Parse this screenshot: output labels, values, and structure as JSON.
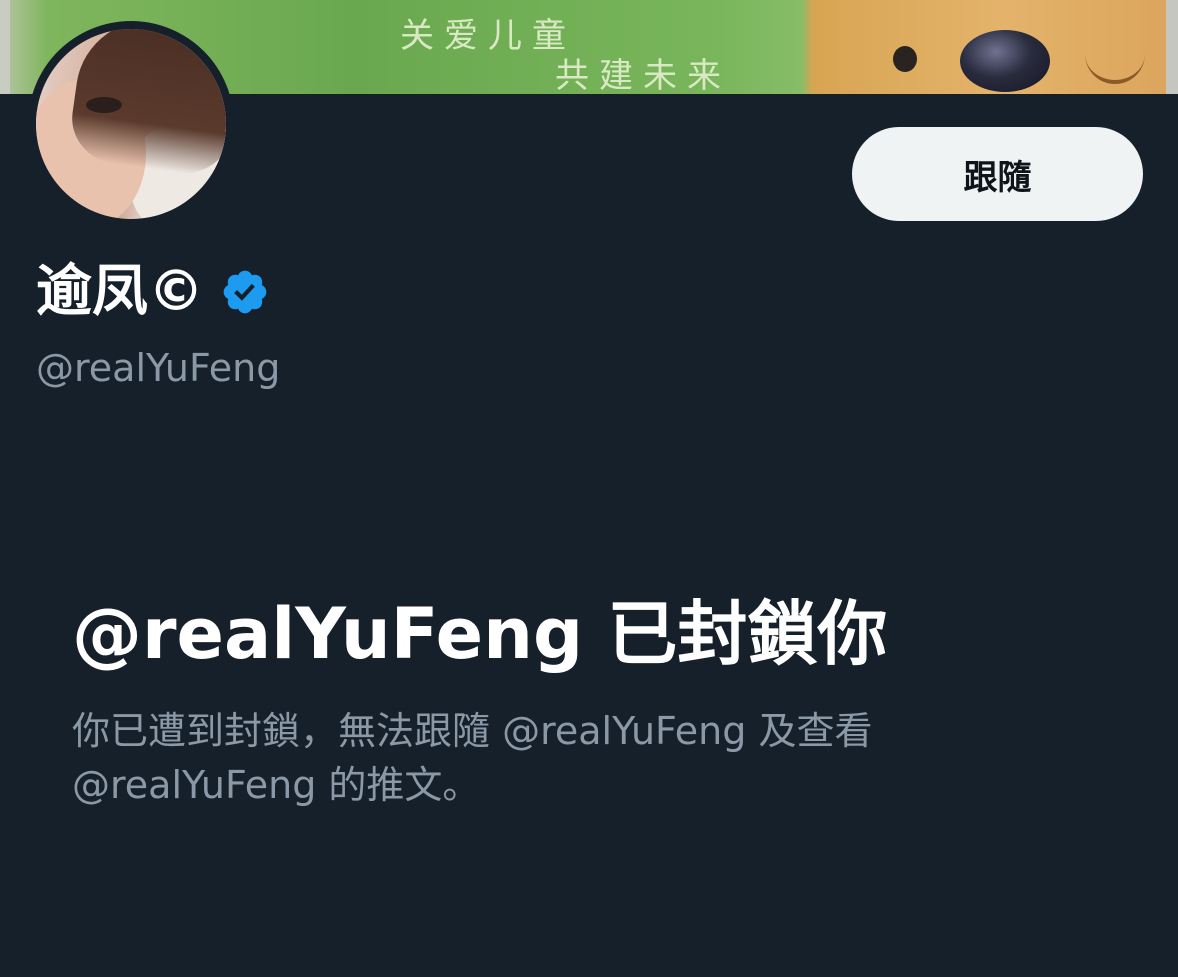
{
  "banner": {
    "caption_line_1": "关爱儿童",
    "caption_line_2": "共建未来"
  },
  "profile": {
    "display_name": "逾凤©",
    "username": "@realYuFeng",
    "verified": true,
    "verified_icon": "verified-badge-icon",
    "accent_color": "#1d9bf0"
  },
  "actions": {
    "follow_label": "跟隨"
  },
  "blocked_notice": {
    "title": "@realYuFeng 已封鎖你",
    "description": "你已遭到封鎖，無法跟隨 @realYuFeng 及查看 @realYuFeng 的推文。"
  },
  "colors": {
    "background": "#15202b",
    "primary_text": "#ffffff",
    "secondary_text": "#8b98a5",
    "button_bg": "#eff3f4"
  }
}
